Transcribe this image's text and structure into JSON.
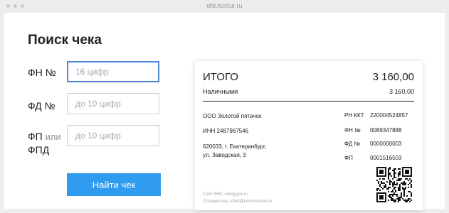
{
  "browser": {
    "url": "ofd.kontur.ru"
  },
  "search": {
    "title": "Поиск чека",
    "fn_label": "ФН №",
    "fn_placeholder": "16 цифр",
    "fd_label": "ФД №",
    "fd_placeholder": "до 10 цифр",
    "fp_label": "ФП",
    "fp_or": "или",
    "fpd_label": "ФПД",
    "fp_placeholder": "до 10 цифр",
    "button": "Найти чек"
  },
  "receipt": {
    "total_label": "ИТОГО",
    "total_value": "3 160,00",
    "cash_label": "Наличными",
    "cash_value": "3 160,00",
    "org_name": "ООО Золотой пятачок",
    "inn": "ИНН 2487967546",
    "address_line1": "620033, г. Екатеринбург,",
    "address_line2": "ул. Заводская, 3",
    "details": [
      {
        "label": "РН ККТ",
        "value": "220004524857"
      },
      {
        "label": "ФН №",
        "value": "0089347888"
      },
      {
        "label": "ФД №",
        "value": "0000000003"
      },
      {
        "label": "ФП",
        "value": "0001516503"
      }
    ],
    "footer_site": "Сайт ФНС nalog.gov.ru",
    "footer_sender": "Отправитель robot@konturcheck.ru",
    "qr_icon": "qr-code-icon"
  }
}
